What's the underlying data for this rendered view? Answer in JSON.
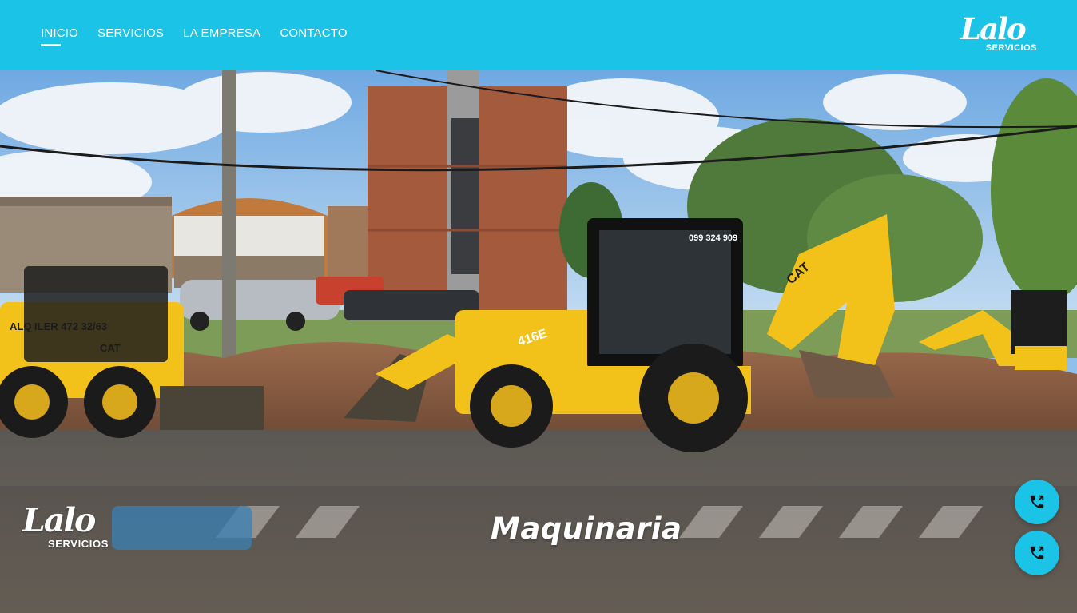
{
  "nav": {
    "items": [
      {
        "label": "INICIO",
        "active": true
      },
      {
        "label": "SERVICIOS",
        "active": false
      },
      {
        "label": "LA EMPRESA",
        "active": false
      },
      {
        "label": "CONTACTO",
        "active": false
      }
    ]
  },
  "brand": {
    "logo_script": "Lalo",
    "logo_word": "SERVICIOS"
  },
  "hero": {
    "title": "Maquinaria",
    "logo_script": "Lalo",
    "logo_word": "SERVICIOS",
    "machine_labels": {
      "backhoe_phone": "099 324 909",
      "backhoe_model": "416E",
      "backhoe_brand": "CAT",
      "skid_brand": "CAT",
      "skid_text": "ALQ ILER 472 32/63"
    }
  },
  "call_buttons": [
    {
      "icon": "phone-icon"
    },
    {
      "icon": "phone-icon"
    }
  ],
  "colors": {
    "accent": "#1bc3e6",
    "text_light": "#ffffff",
    "machine_yellow": "#f2c21b"
  }
}
